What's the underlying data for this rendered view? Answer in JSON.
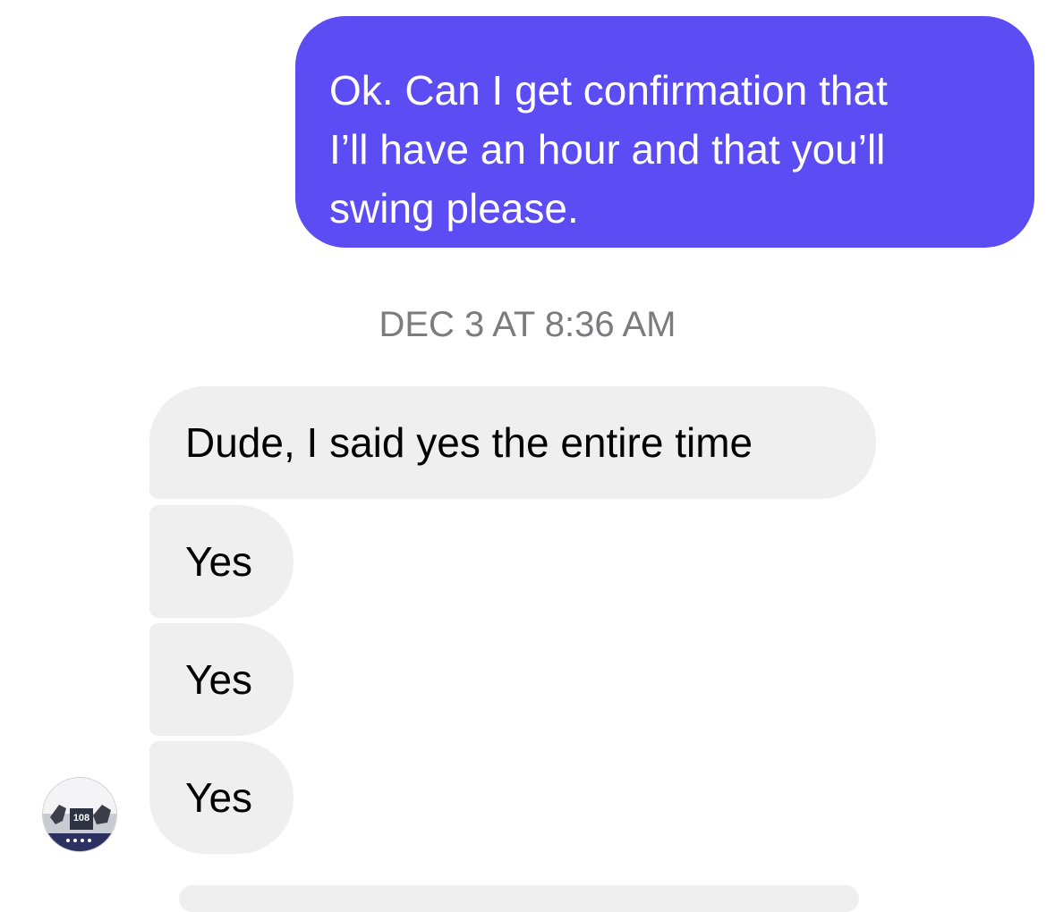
{
  "conversation": {
    "sent_message": "Ok. Can I get confirmation that\nI’ll have an hour and that you’ll\nswing please.",
    "timestamp": "DEC 3 AT 8:36 AM",
    "received_messages": [
      "Dude, I said yes the entire time",
      "Yes",
      "Yes",
      "Yes"
    ],
    "avatar": {
      "icon": "profile-avatar-icon",
      "number_text": "108"
    }
  },
  "colors": {
    "sent_bubble": "#5b4cf4",
    "received_bubble": "#efefef",
    "timestamp_text": "#7b7b80",
    "background": "#ffffff"
  }
}
